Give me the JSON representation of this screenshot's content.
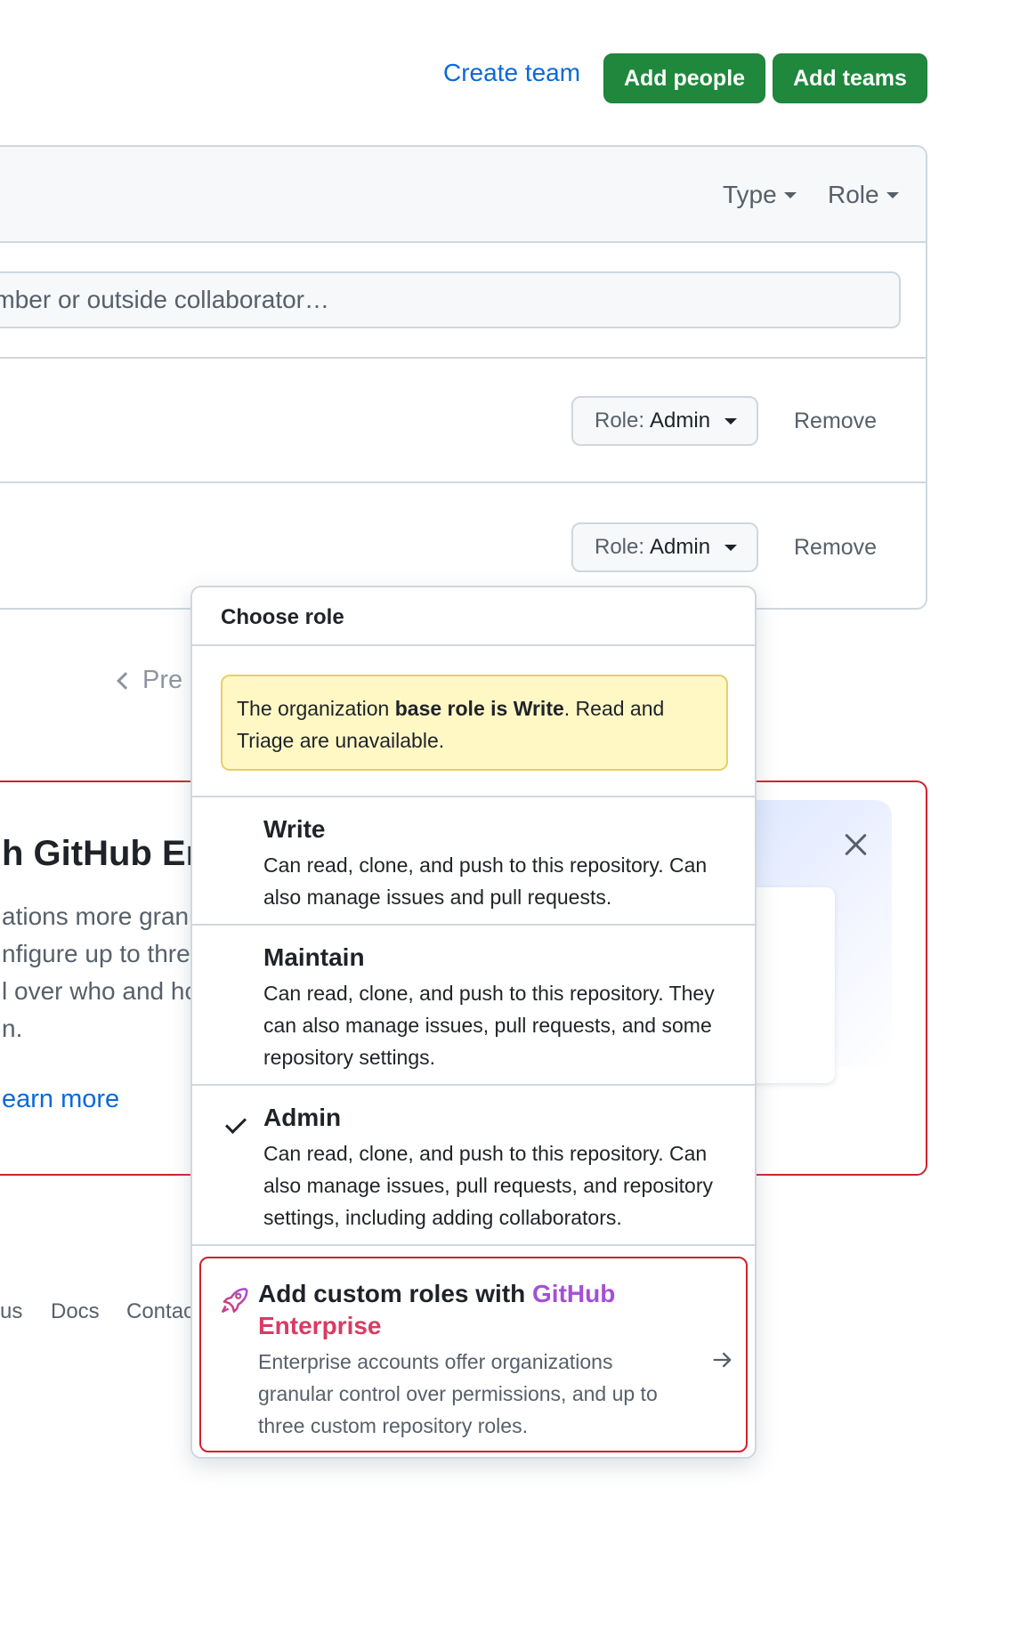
{
  "header": {
    "create_team": "Create team",
    "add_people": "Add people",
    "add_teams": "Add teams"
  },
  "filters": {
    "type": "Type",
    "role": "Role"
  },
  "search": {
    "placeholder": "mber or outside collaborator…"
  },
  "members": [
    {
      "role_prefix": "Role:",
      "role_value": "Admin",
      "remove": "Remove"
    },
    {
      "role_prefix": "Role:",
      "role_value": "Admin",
      "remove": "Remove"
    }
  ],
  "pagination": {
    "prev": "Pre"
  },
  "promo": {
    "title": "h GitHub En",
    "desc_lines": [
      "ations more granu",
      "nfigure up to thre",
      "l over who and hc",
      "n."
    ],
    "learn_more": "earn more"
  },
  "footer": {
    "links": [
      "us",
      "Docs",
      "Contac"
    ]
  },
  "dropdown": {
    "title": "Choose role",
    "notice": {
      "pre": "The organization ",
      "bold": "base role is Write",
      "post": ". Read and Triage are unavailable."
    },
    "options": [
      {
        "name": "Write",
        "desc": "Can read, clone, and push to this repository. Can also manage issues and pull requests.",
        "selected": false
      },
      {
        "name": "Maintain",
        "desc": "Can read, clone, and push to this repository. They can also manage issues, pull requests, and some repository settings.",
        "selected": false
      },
      {
        "name": "Admin",
        "desc": "Can read, clone, and push to this repository. Can also manage issues, pull requests, and repository settings, including adding collaborators.",
        "selected": true
      }
    ],
    "upsell": {
      "title_pre": "Add custom roles with ",
      "title_gh": "GitHub",
      "title_ent": "Enterprise",
      "desc": "Enterprise accounts offer organizations granular control over permissions, and up to three custom repository roles."
    }
  },
  "colors": {
    "primary_green": "#1f883d",
    "link_blue": "#0969da",
    "danger_red": "#cf222e",
    "notice_yellow": "#fff8c5"
  }
}
